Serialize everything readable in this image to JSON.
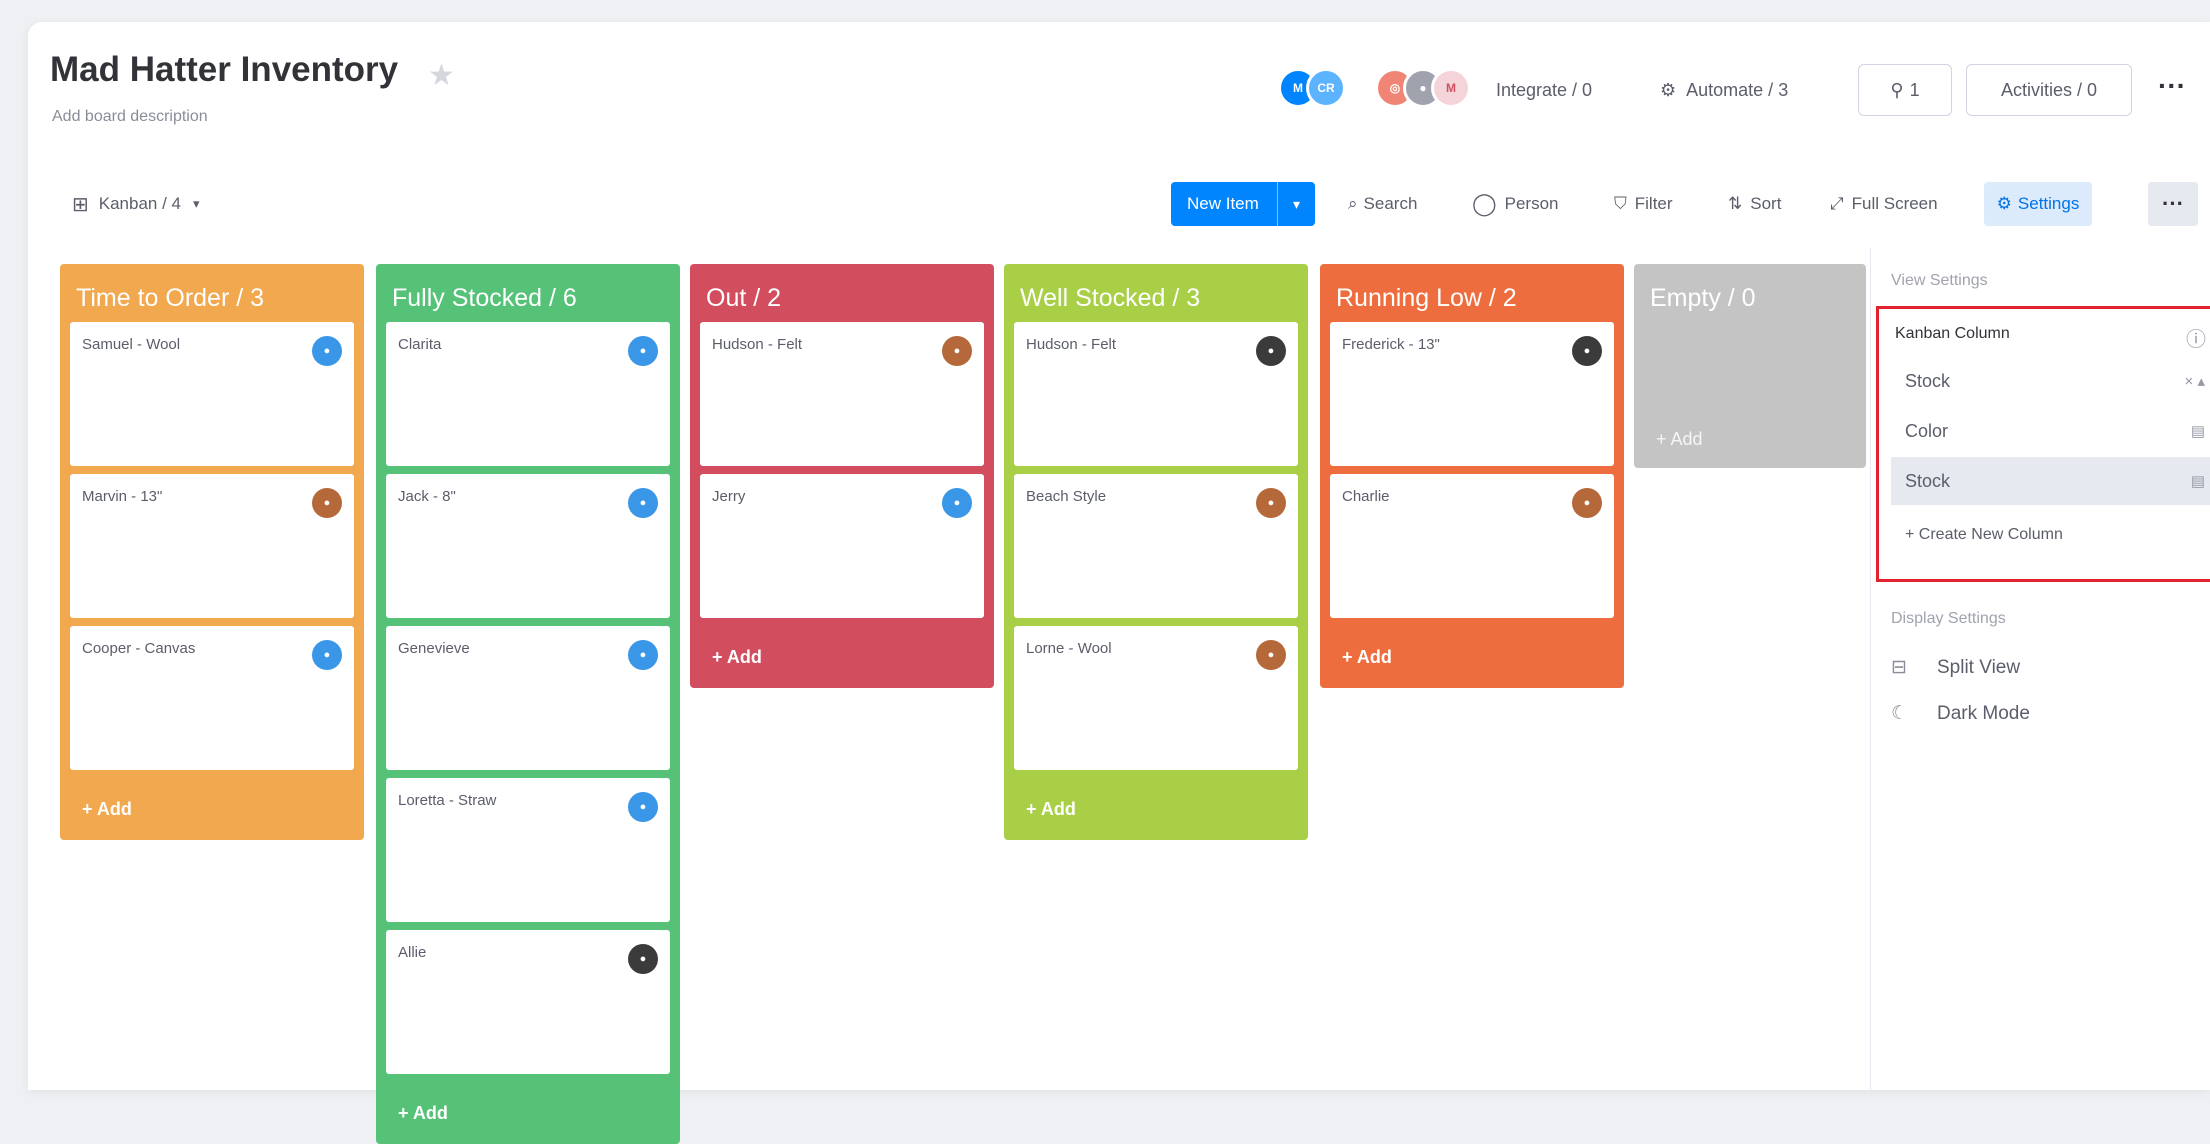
{
  "board": {
    "title": "Mad Hatter Inventory",
    "description": "Add board description"
  },
  "header": {
    "integrate": "Integrate / 0",
    "automate": "Automate / 3",
    "members": "1",
    "activities": "Activities / 0"
  },
  "toolbar": {
    "view": "Kanban / 4",
    "new_item": "New Item",
    "search": "Search",
    "person": "Person",
    "filter": "Filter",
    "sort": "Sort",
    "fullscreen": "Full Screen",
    "settings": "Settings"
  },
  "columns": [
    {
      "title": "Time to Order / 3",
      "color": "#f2a84e",
      "cards": [
        {
          "name": "Samuel - Wool",
          "avatar": "blue"
        },
        {
          "name": "Marvin - 13\"",
          "avatar": "photo"
        },
        {
          "name": "Cooper - Canvas",
          "avatar": "blue"
        }
      ],
      "add": "+ Add"
    },
    {
      "title": "Fully Stocked / 6",
      "color": "#55c278",
      "cards": [
        {
          "name": "Clarita",
          "avatar": "blue"
        },
        {
          "name": "Jack - 8\"",
          "avatar": "blue"
        },
        {
          "name": "Genevieve",
          "avatar": "blue"
        },
        {
          "name": "Loretta - Straw",
          "avatar": "blue"
        },
        {
          "name": "Allie",
          "avatar": "dark"
        }
      ],
      "add": "+ Add"
    },
    {
      "title": "Out / 2",
      "color": "#d24e5f",
      "cards": [
        {
          "name": "Hudson - Felt",
          "avatar": "photo"
        },
        {
          "name": "Jerry",
          "avatar": "blue"
        }
      ],
      "add": "+ Add"
    },
    {
      "title": "Well Stocked / 3",
      "color": "#a8cf46",
      "cards": [
        {
          "name": "Hudson - Felt",
          "avatar": "dark"
        },
        {
          "name": "Beach Style",
          "avatar": "photo"
        },
        {
          "name": "Lorne - Wool",
          "avatar": "photo"
        }
      ],
      "add": "+ Add"
    },
    {
      "title": "Running Low / 2",
      "color": "#ee6d3e",
      "cards": [
        {
          "name": "Frederick - 13\"",
          "avatar": "dark"
        },
        {
          "name": "Charlie",
          "avatar": "photo"
        }
      ],
      "add": "+ Add"
    },
    {
      "title": "Empty / 0",
      "color": "#c4c4c4",
      "cards": [],
      "add": "+ Add"
    }
  ],
  "sidebar": {
    "view_settings": "View Settings",
    "kanban_column": "Kanban Column",
    "options": [
      "Stock",
      "Color",
      "Stock"
    ],
    "create_new": "+ Create New Column",
    "display_settings": "Display Settings",
    "split_view": "Split View",
    "dark_mode": "Dark Mode"
  }
}
